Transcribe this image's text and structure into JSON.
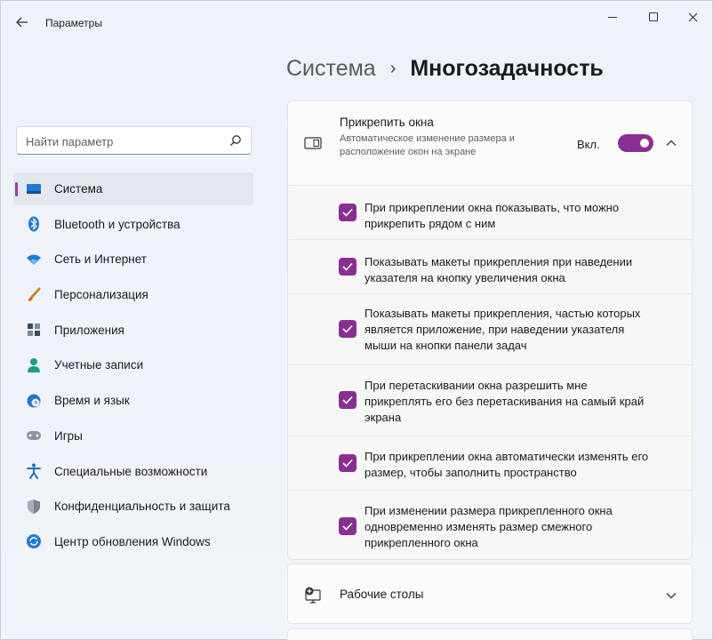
{
  "window": {
    "title": "Параметры",
    "back_icon": "back-arrow-icon"
  },
  "search": {
    "placeholder": "Найти параметр",
    "value": ""
  },
  "sidebar": {
    "items": [
      {
        "label": "Система",
        "icon": "system-display-icon",
        "active": true
      },
      {
        "label": "Bluetooth и устройства",
        "icon": "bluetooth-icon",
        "active": false
      },
      {
        "label": "Сеть и Интернет",
        "icon": "wifi-icon",
        "active": false
      },
      {
        "label": "Персонализация",
        "icon": "brush-icon",
        "active": false
      },
      {
        "label": "Приложения",
        "icon": "apps-icon",
        "active": false
      },
      {
        "label": "Учетные записи",
        "icon": "account-icon",
        "active": false
      },
      {
        "label": "Время и язык",
        "icon": "globe-clock-icon",
        "active": false
      },
      {
        "label": "Игры",
        "icon": "gamepad-icon",
        "active": false
      },
      {
        "label": "Специальные возможности",
        "icon": "accessibility-icon",
        "active": false
      },
      {
        "label": "Конфиденциальность и защита",
        "icon": "shield-icon",
        "active": false
      },
      {
        "label": "Центр обновления Windows",
        "icon": "update-icon",
        "active": false
      }
    ]
  },
  "page": {
    "breadcrumb_parent": "Система",
    "breadcrumb_separator": "›",
    "title": "Многозадачность"
  },
  "snap": {
    "title": "Прикрепить окна",
    "description": "Автоматическое изменение размера и расположение окон на экране",
    "toggle_label": "Вкл.",
    "toggle_on": true,
    "options": [
      {
        "text": "При прикреплении окна показывать, что можно прикрепить рядом с ним",
        "checked": true
      },
      {
        "text": "Показывать макеты прикрепления при наведении указателя на кнопку увеличения окна",
        "checked": true
      },
      {
        "text": "Показывать макеты прикрепления, частью которых является приложение, при наведении указателя мыши на кнопки панели задач",
        "checked": true
      },
      {
        "text": "При перетаскивании окна разрешить мне прикреплять его без перетаскивания на самый край экрана",
        "checked": true
      },
      {
        "text": "При прикреплении окна автоматически изменять его размер, чтобы заполнить пространство",
        "checked": true
      },
      {
        "text": "При изменении размера прикрепленного окна одновременно изменять размер смежного прикрепленного окна",
        "checked": true
      }
    ]
  },
  "desktops": {
    "label": "Рабочие столы"
  },
  "colors": {
    "accent": "#8a2f92",
    "background": "#eef2f9",
    "card": "#fbfbfc"
  }
}
